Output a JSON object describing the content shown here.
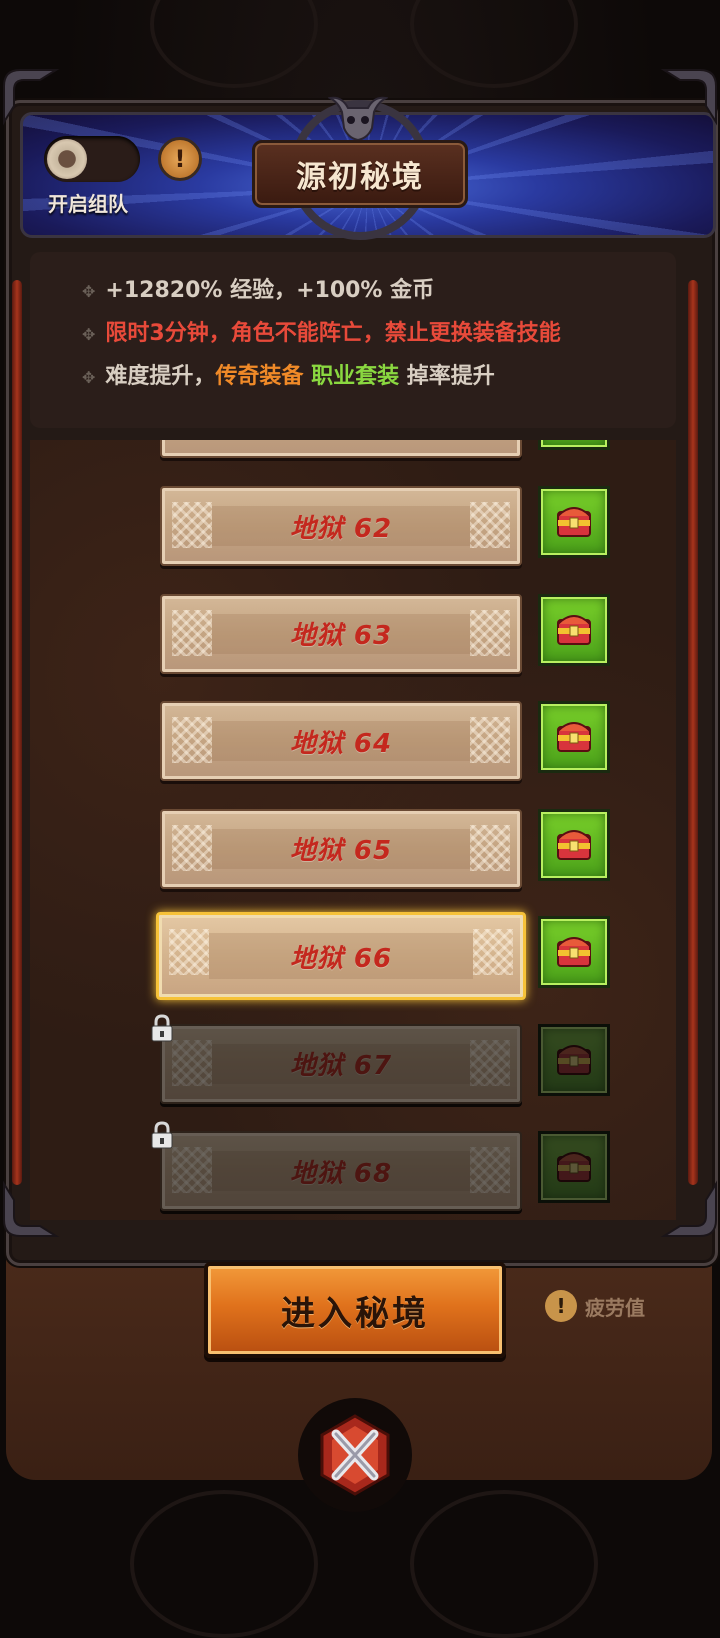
{
  "header": {
    "title": "源初秘境",
    "team_label": "开启组队",
    "team_toggle_on": false,
    "info_icon": "exclamation-icon"
  },
  "info": {
    "line1": "+12820% 经验，+100% 金币",
    "line2": "限时3分钟，角色不能阵亡，禁止更换装备技能",
    "line3_prefix": "难度提升，",
    "line3_legendary": "传奇装备",
    "line3_set": "职业套装",
    "line3_suffix": "掉率提升"
  },
  "levels": [
    {
      "label": "地狱 62",
      "locked": false,
      "selected": false
    },
    {
      "label": "地狱 63",
      "locked": false,
      "selected": false
    },
    {
      "label": "地狱 64",
      "locked": false,
      "selected": false
    },
    {
      "label": "地狱 65",
      "locked": false,
      "selected": false
    },
    {
      "label": "地狱 66",
      "locked": false,
      "selected": true
    },
    {
      "label": "地狱 67",
      "locked": true,
      "selected": false
    },
    {
      "label": "地狱 68",
      "locked": true,
      "selected": false
    }
  ],
  "footer": {
    "enter_label": "进入秘境",
    "fatigue_label": "疲劳值",
    "fatigue_icon": "exclamation-icon",
    "close_icon": "close-x-icon"
  },
  "colors": {
    "warning_red": "#e84a3a",
    "legendary_orange": "#f08a28",
    "set_green": "#8ad840",
    "selected_gold": "#f6c238"
  }
}
